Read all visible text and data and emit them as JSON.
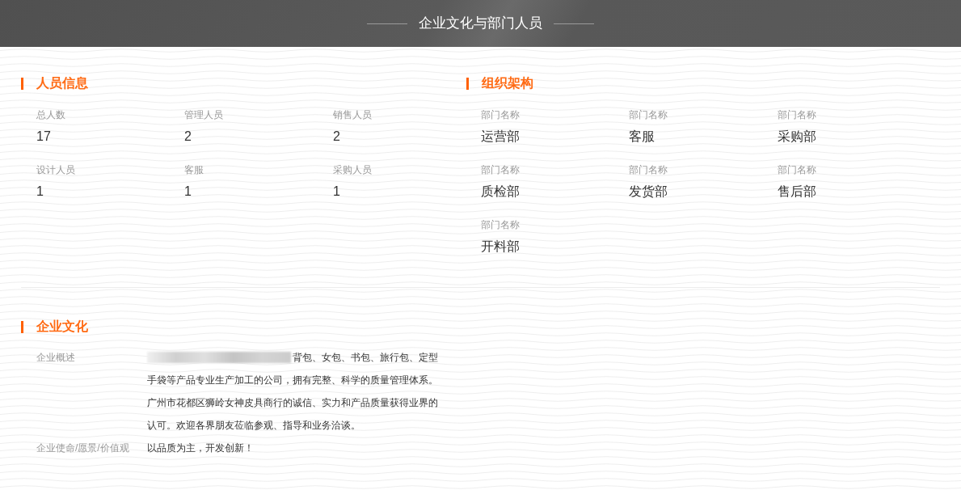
{
  "header": {
    "title": "企业文化与部门人员"
  },
  "staff_info": {
    "title": "人员信息",
    "stats": [
      {
        "label": "总人数",
        "value": "17"
      },
      {
        "label": "管理人员",
        "value": "2"
      },
      {
        "label": "销售人员",
        "value": "2"
      },
      {
        "label": "设计人员",
        "value": "1"
      },
      {
        "label": "客服",
        "value": "1"
      },
      {
        "label": "采购人员",
        "value": "1"
      }
    ]
  },
  "org_structure": {
    "title": "组织架构",
    "departments": [
      {
        "label": "部门名称",
        "name": "运营部"
      },
      {
        "label": "部门名称",
        "name": "客服"
      },
      {
        "label": "部门名称",
        "name": "采购部"
      },
      {
        "label": "部门名称",
        "name": "质检部"
      },
      {
        "label": "部门名称",
        "name": "发货部"
      },
      {
        "label": "部门名称",
        "name": "售后部"
      },
      {
        "label": "部门名称",
        "name": "开料部"
      }
    ]
  },
  "culture": {
    "title": "企业文化",
    "rows": [
      {
        "label": "企业概述",
        "redacted": true,
        "text": "背包、女包、书包、旅行包、定型手袋等产品专业生产加工的公司，拥有完整、科学的质量管理体系。广州市花都区狮岭女神皮具商行的诚信、实力和产品质量获得业界的认可。欢迎各界朋友莅临参观、指导和业务洽谈。"
      },
      {
        "label": "企业使命/愿景/价值观",
        "redacted": false,
        "text": "以品质为主，开发创新！"
      }
    ]
  }
}
